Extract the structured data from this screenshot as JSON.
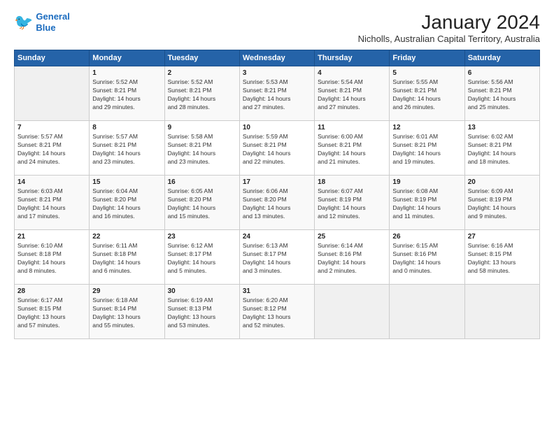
{
  "logo": {
    "line1": "General",
    "line2": "Blue"
  },
  "title": "January 2024",
  "location": "Nicholls, Australian Capital Territory, Australia",
  "headers": [
    "Sunday",
    "Monday",
    "Tuesday",
    "Wednesday",
    "Thursday",
    "Friday",
    "Saturday"
  ],
  "weeks": [
    [
      {
        "day": "",
        "info": ""
      },
      {
        "day": "1",
        "info": "Sunrise: 5:52 AM\nSunset: 8:21 PM\nDaylight: 14 hours\nand 29 minutes."
      },
      {
        "day": "2",
        "info": "Sunrise: 5:52 AM\nSunset: 8:21 PM\nDaylight: 14 hours\nand 28 minutes."
      },
      {
        "day": "3",
        "info": "Sunrise: 5:53 AM\nSunset: 8:21 PM\nDaylight: 14 hours\nand 27 minutes."
      },
      {
        "day": "4",
        "info": "Sunrise: 5:54 AM\nSunset: 8:21 PM\nDaylight: 14 hours\nand 27 minutes."
      },
      {
        "day": "5",
        "info": "Sunrise: 5:55 AM\nSunset: 8:21 PM\nDaylight: 14 hours\nand 26 minutes."
      },
      {
        "day": "6",
        "info": "Sunrise: 5:56 AM\nSunset: 8:21 PM\nDaylight: 14 hours\nand 25 minutes."
      }
    ],
    [
      {
        "day": "7",
        "info": "Sunrise: 5:57 AM\nSunset: 8:21 PM\nDaylight: 14 hours\nand 24 minutes."
      },
      {
        "day": "8",
        "info": "Sunrise: 5:57 AM\nSunset: 8:21 PM\nDaylight: 14 hours\nand 23 minutes."
      },
      {
        "day": "9",
        "info": "Sunrise: 5:58 AM\nSunset: 8:21 PM\nDaylight: 14 hours\nand 23 minutes."
      },
      {
        "day": "10",
        "info": "Sunrise: 5:59 AM\nSunset: 8:21 PM\nDaylight: 14 hours\nand 22 minutes."
      },
      {
        "day": "11",
        "info": "Sunrise: 6:00 AM\nSunset: 8:21 PM\nDaylight: 14 hours\nand 21 minutes."
      },
      {
        "day": "12",
        "info": "Sunrise: 6:01 AM\nSunset: 8:21 PM\nDaylight: 14 hours\nand 19 minutes."
      },
      {
        "day": "13",
        "info": "Sunrise: 6:02 AM\nSunset: 8:21 PM\nDaylight: 14 hours\nand 18 minutes."
      }
    ],
    [
      {
        "day": "14",
        "info": "Sunrise: 6:03 AM\nSunset: 8:21 PM\nDaylight: 14 hours\nand 17 minutes."
      },
      {
        "day": "15",
        "info": "Sunrise: 6:04 AM\nSunset: 8:20 PM\nDaylight: 14 hours\nand 16 minutes."
      },
      {
        "day": "16",
        "info": "Sunrise: 6:05 AM\nSunset: 8:20 PM\nDaylight: 14 hours\nand 15 minutes."
      },
      {
        "day": "17",
        "info": "Sunrise: 6:06 AM\nSunset: 8:20 PM\nDaylight: 14 hours\nand 13 minutes."
      },
      {
        "day": "18",
        "info": "Sunrise: 6:07 AM\nSunset: 8:19 PM\nDaylight: 14 hours\nand 12 minutes."
      },
      {
        "day": "19",
        "info": "Sunrise: 6:08 AM\nSunset: 8:19 PM\nDaylight: 14 hours\nand 11 minutes."
      },
      {
        "day": "20",
        "info": "Sunrise: 6:09 AM\nSunset: 8:19 PM\nDaylight: 14 hours\nand 9 minutes."
      }
    ],
    [
      {
        "day": "21",
        "info": "Sunrise: 6:10 AM\nSunset: 8:18 PM\nDaylight: 14 hours\nand 8 minutes."
      },
      {
        "day": "22",
        "info": "Sunrise: 6:11 AM\nSunset: 8:18 PM\nDaylight: 14 hours\nand 6 minutes."
      },
      {
        "day": "23",
        "info": "Sunrise: 6:12 AM\nSunset: 8:17 PM\nDaylight: 14 hours\nand 5 minutes."
      },
      {
        "day": "24",
        "info": "Sunrise: 6:13 AM\nSunset: 8:17 PM\nDaylight: 14 hours\nand 3 minutes."
      },
      {
        "day": "25",
        "info": "Sunrise: 6:14 AM\nSunset: 8:16 PM\nDaylight: 14 hours\nand 2 minutes."
      },
      {
        "day": "26",
        "info": "Sunrise: 6:15 AM\nSunset: 8:16 PM\nDaylight: 14 hours\nand 0 minutes."
      },
      {
        "day": "27",
        "info": "Sunrise: 6:16 AM\nSunset: 8:15 PM\nDaylight: 13 hours\nand 58 minutes."
      }
    ],
    [
      {
        "day": "28",
        "info": "Sunrise: 6:17 AM\nSunset: 8:15 PM\nDaylight: 13 hours\nand 57 minutes."
      },
      {
        "day": "29",
        "info": "Sunrise: 6:18 AM\nSunset: 8:14 PM\nDaylight: 13 hours\nand 55 minutes."
      },
      {
        "day": "30",
        "info": "Sunrise: 6:19 AM\nSunset: 8:13 PM\nDaylight: 13 hours\nand 53 minutes."
      },
      {
        "day": "31",
        "info": "Sunrise: 6:20 AM\nSunset: 8:12 PM\nDaylight: 13 hours\nand 52 minutes."
      },
      {
        "day": "",
        "info": ""
      },
      {
        "day": "",
        "info": ""
      },
      {
        "day": "",
        "info": ""
      }
    ]
  ]
}
